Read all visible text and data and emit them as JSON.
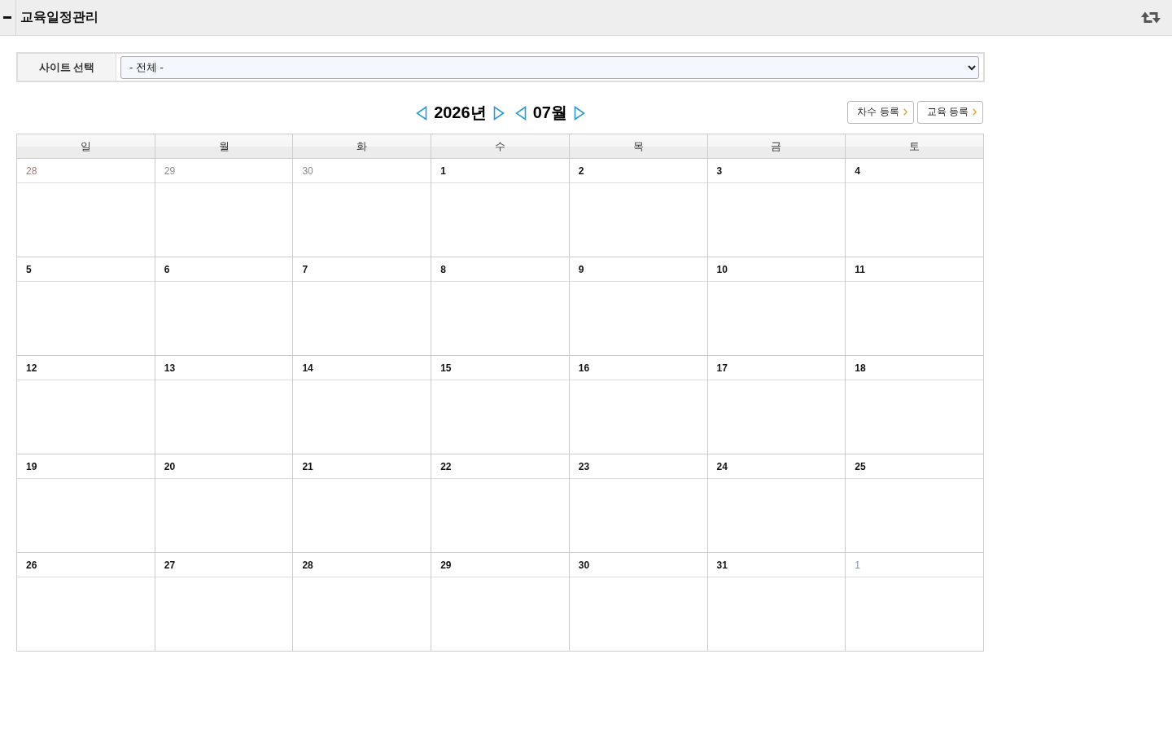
{
  "header": {
    "title": "교육일정관리"
  },
  "filter": {
    "label": "사이트 선택",
    "select": {
      "value": "- 전체 -"
    }
  },
  "navigation": {
    "year": "2026년",
    "month": "07월"
  },
  "buttons": [
    {
      "label": "차수 등록"
    },
    {
      "label": "교육 등록"
    }
  ],
  "calendar": {
    "weekdays": [
      "일",
      "월",
      "화",
      "수",
      "목",
      "금",
      "토"
    ],
    "weeks": [
      [
        {
          "day": "28",
          "muted": true
        },
        {
          "day": "29",
          "muted": true
        },
        {
          "day": "30",
          "muted": true
        },
        {
          "day": "1",
          "muted": false
        },
        {
          "day": "2",
          "muted": false
        },
        {
          "day": "3",
          "muted": false
        },
        {
          "day": "4",
          "muted": false
        }
      ],
      [
        {
          "day": "5",
          "muted": false
        },
        {
          "day": "6",
          "muted": false
        },
        {
          "day": "7",
          "muted": false
        },
        {
          "day": "8",
          "muted": false
        },
        {
          "day": "9",
          "muted": false
        },
        {
          "day": "10",
          "muted": false
        },
        {
          "day": "11",
          "muted": false
        }
      ],
      [
        {
          "day": "12",
          "muted": false
        },
        {
          "day": "13",
          "muted": false
        },
        {
          "day": "14",
          "muted": false
        },
        {
          "day": "15",
          "muted": false
        },
        {
          "day": "16",
          "muted": false
        },
        {
          "day": "17",
          "muted": false
        },
        {
          "day": "18",
          "muted": false
        }
      ],
      [
        {
          "day": "19",
          "muted": false
        },
        {
          "day": "20",
          "muted": false
        },
        {
          "day": "21",
          "muted": false
        },
        {
          "day": "22",
          "muted": false
        },
        {
          "day": "23",
          "muted": false
        },
        {
          "day": "24",
          "muted": false
        },
        {
          "day": "25",
          "muted": false
        }
      ],
      [
        {
          "day": "26",
          "muted": false
        },
        {
          "day": "27",
          "muted": false
        },
        {
          "day": "28",
          "muted": false
        },
        {
          "day": "29",
          "muted": false
        },
        {
          "day": "30",
          "muted": false
        },
        {
          "day": "31",
          "muted": false
        },
        {
          "day": "1",
          "muted": true
        }
      ]
    ]
  }
}
